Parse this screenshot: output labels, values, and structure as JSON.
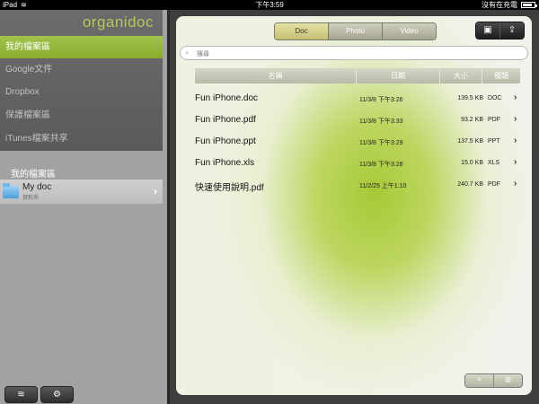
{
  "status": {
    "device": "iPad",
    "time": "下午3:59",
    "charging": "沒有在充電"
  },
  "sidebar": {
    "logo": "organidoc",
    "nav": [
      "我的檔案區",
      "Google文件",
      "Dropbox",
      "保護檔案區",
      "iTunes檔案共享"
    ],
    "active_index": 0,
    "section_title": "我的檔案區",
    "folder": {
      "name": "My doc",
      "sub": "資料夾"
    }
  },
  "toolbar": {
    "segments": [
      "Doc",
      "Photo",
      "Video"
    ],
    "active_segment": "Doc"
  },
  "search": {
    "placeholder": "搜尋"
  },
  "table": {
    "headers": [
      "名稱",
      "日期",
      "大小",
      "種類"
    ],
    "rows": [
      {
        "name": "Fun iPhone.doc",
        "date": "11/3/8 下午3:26",
        "size": "139.5 KB",
        "type": "DOC"
      },
      {
        "name": "Fun iPhone.pdf",
        "date": "11/3/8 下午3:33",
        "size": "93.2 KB",
        "type": "PDF"
      },
      {
        "name": "Fun iPhone.ppt",
        "date": "11/3/8 下午3:29",
        "size": "137.5 KB",
        "type": "PPT"
      },
      {
        "name": "Fun iPhone.xls",
        "date": "11/3/8 下午3:28",
        "size": "15.0 KB",
        "type": "XLS"
      },
      {
        "name": "快速使用說明.pdf",
        "date": "11/2/25 上午1:10",
        "size": "240.7 KB",
        "type": "PDF"
      }
    ]
  },
  "colors": {
    "accent": "#94b43a",
    "logo": "#b7c85a"
  }
}
